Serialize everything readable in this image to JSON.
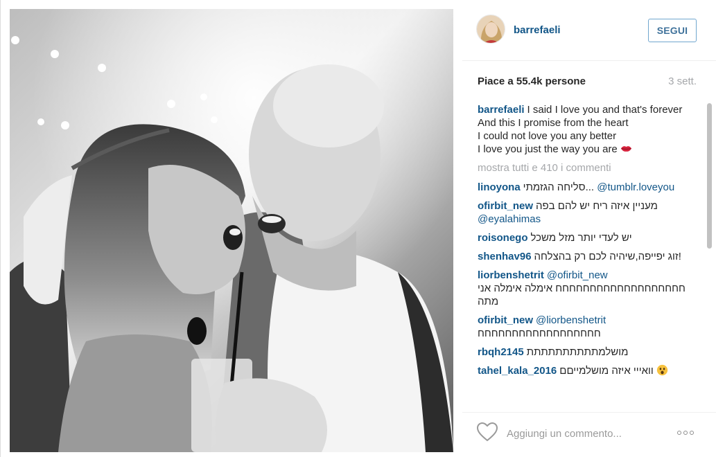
{
  "post": {
    "username": "barrefaeli",
    "follow_label": "SEGUI",
    "likes_text": "Piace a 55.4k persone",
    "time_ago": "3 sett.",
    "show_all_comments": "mostra tutti e 410 i commenti",
    "comment_placeholder": "Aggiungi un commento..."
  },
  "caption": {
    "username": "barrefaeli",
    "text": "I said I love you and that's forever\nAnd this I promise from the heart\nI could not love you any better\nI love you just the way you are",
    "emoji": "kiss-lips-icon"
  },
  "comments": [
    {
      "username": "linoyona",
      "text": "סליחה הגזמתי...",
      "mention": "@tumblr.loveyou"
    },
    {
      "username": "ofirbit_new",
      "text": "מעניין איזה ריח יש להם בפה",
      "mention": "@eyalahimas"
    },
    {
      "username": "roisonego",
      "text": "יש לעדי יותר מזל משכל",
      "mention": ""
    },
    {
      "username": "shenhav96",
      "text": "זוג יפייפה,שיהיה לכם רק בהצלחה!",
      "mention": ""
    },
    {
      "username": "liorbenshetrit",
      "text": "חחחחחחחחחחחחחחחחחחח אימלה אימלה אני מתה",
      "mention": "@ofirbit_new"
    },
    {
      "username": "ofirbit_new",
      "text": "חחחחחחחחחחחחחחחחחח",
      "mention": "@liorbenshetrit"
    },
    {
      "username": "rbqh2145",
      "text": "מושלמתתתתתתתתתת",
      "mention": ""
    },
    {
      "username": "tahel_kala_2016",
      "text": "וואייי איזה מושלמייםם",
      "mention": "",
      "emoji": "astonished-face-icon"
    }
  ],
  "colors": {
    "username_blue": "#125688",
    "follow_border": "#70a6cf",
    "muted_gray": "#a5a7aa"
  }
}
